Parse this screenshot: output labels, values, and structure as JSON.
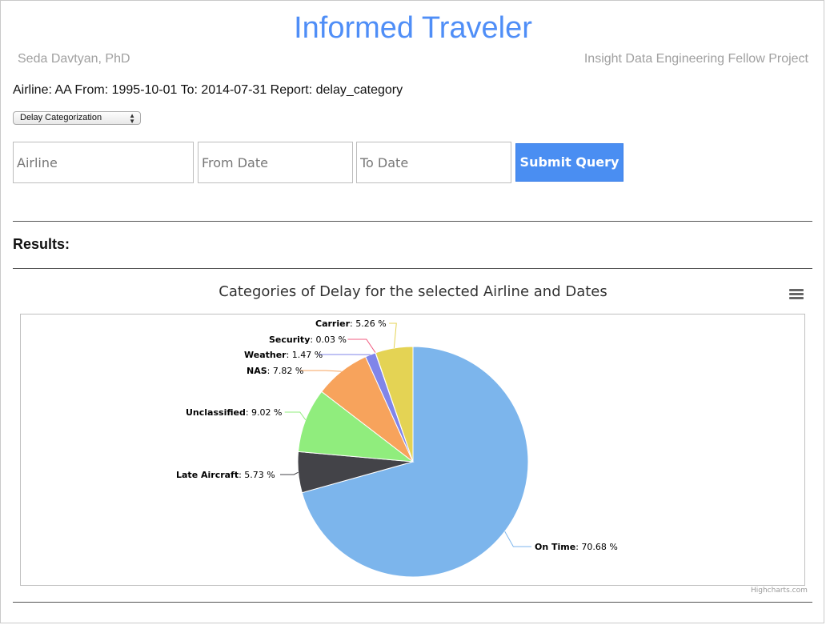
{
  "header": {
    "title": "Informed Traveler",
    "author": "Seda Davtyan, PhD",
    "project": "Insight Data Engineering Fellow Project"
  },
  "query_summary": "Airline: AA From: 1995-10-01 To: 2014-07-31 Report: delay_category",
  "report_select": {
    "selected": "Delay Categorization"
  },
  "form": {
    "airline_placeholder": "Airline",
    "from_placeholder": "From Date",
    "to_placeholder": "To Date",
    "submit_label": "Submit Query"
  },
  "results_heading": "Results:",
  "icons": {
    "chart_menu": "hamburger-menu-icon"
  },
  "credit": "Highcharts.com",
  "chart_data": {
    "type": "pie",
    "title": "Categories of Delay for the selected Airline and Dates",
    "unit": "%",
    "slices": [
      {
        "name": "On Time",
        "value": 70.68,
        "color": "#7cb5ec"
      },
      {
        "name": "Late Aircraft",
        "value": 5.73,
        "color": "#434348"
      },
      {
        "name": "Unclassified",
        "value": 9.02,
        "color": "#90ed7d"
      },
      {
        "name": "NAS",
        "value": 7.82,
        "color": "#f7a35c"
      },
      {
        "name": "Weather",
        "value": 1.47,
        "color": "#8085e9"
      },
      {
        "name": "Security",
        "value": 0.03,
        "color": "#f15c80"
      },
      {
        "name": "Carrier",
        "value": 5.26,
        "color": "#e4d354"
      }
    ]
  }
}
